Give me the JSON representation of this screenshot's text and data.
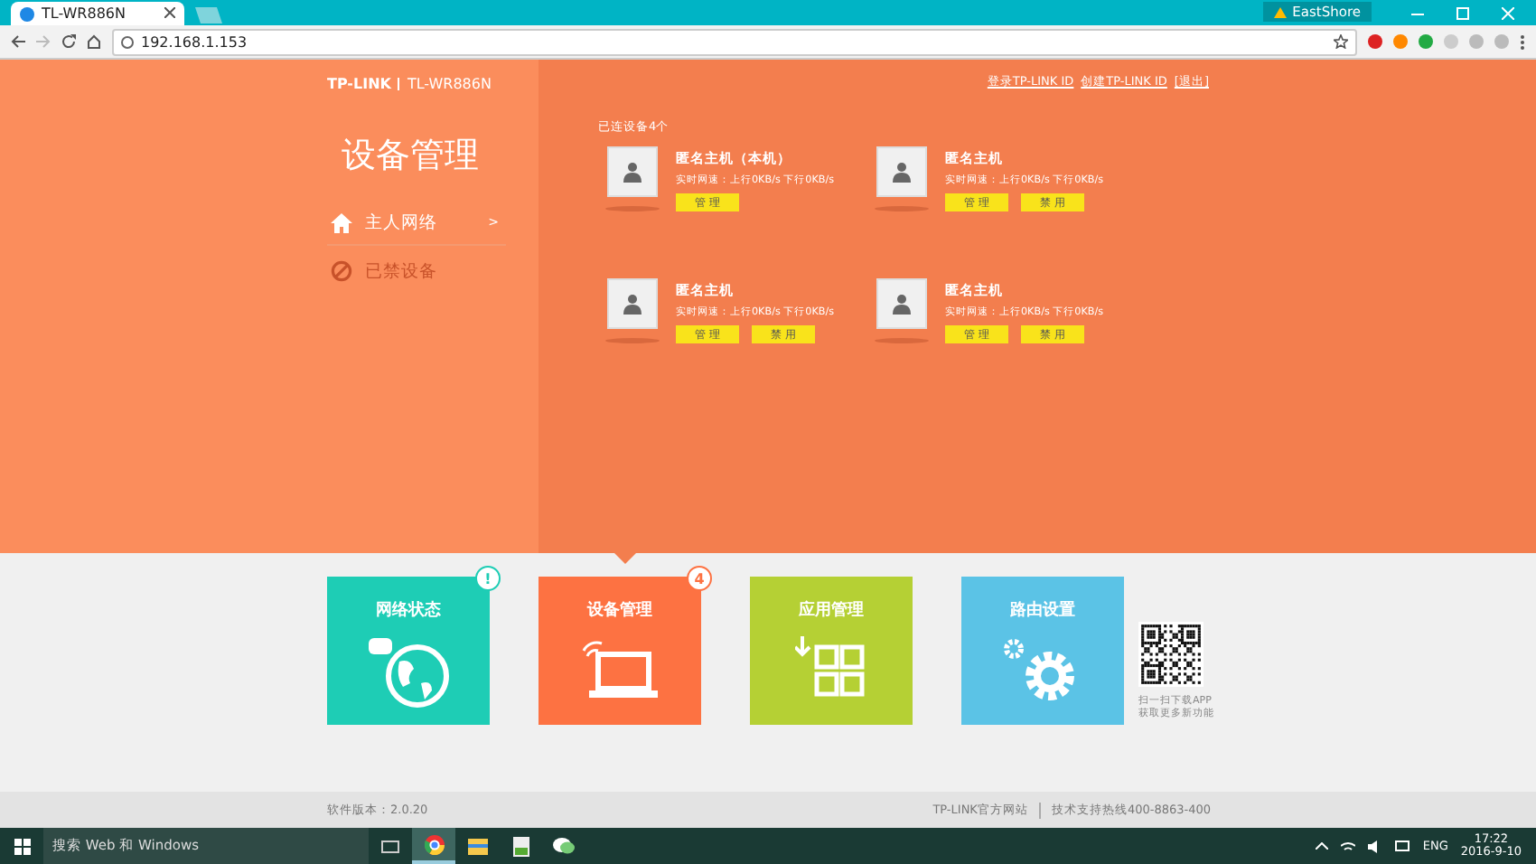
{
  "browser": {
    "tab_title": "TL-WR886N",
    "profile": "EastShore",
    "address": "192.168.1.153"
  },
  "header": {
    "brand": "TP-LINK",
    "model": "TL-WR886N",
    "links": [
      "登录TP-LINK ID",
      "创建TP-LINK ID",
      "[退出]"
    ]
  },
  "sidebar": {
    "title": "设备管理",
    "items": [
      {
        "label": "主人网络",
        "arrow": ">",
        "selected": true
      },
      {
        "label": "已禁设备",
        "selected": false
      }
    ]
  },
  "devices": {
    "count": "已连设备4个",
    "list": [
      {
        "name": "匿名主机（本机）",
        "speed": "实时网速：上行0KB/s  下行0KB/s",
        "buttons": [
          "管 理"
        ]
      },
      {
        "name": "匿名主机",
        "speed": "实时网速：上行0KB/s  下行0KB/s",
        "buttons": [
          "管 理",
          "禁 用"
        ]
      },
      {
        "name": "匿名主机",
        "speed": "实时网速：上行0KB/s  下行0KB/s",
        "buttons": [
          "管 理",
          "禁 用"
        ]
      },
      {
        "name": "匿名主机",
        "speed": "实时网速：上行0KB/s  下行0KB/s",
        "buttons": [
          "管 理",
          "禁 用"
        ]
      }
    ]
  },
  "tiles": [
    {
      "kind": "network",
      "label": "网络状态",
      "badge": "!",
      "color": "#1ecdb5",
      "selected": false
    },
    {
      "kind": "devices",
      "label": "设备管理",
      "badge": "4",
      "color": "#fd7242",
      "selected": true
    },
    {
      "kind": "apps",
      "label": "应用管理",
      "color": "#b5d034",
      "selected": false
    },
    {
      "kind": "router",
      "label": "路由设置",
      "color": "#5bc3e6",
      "selected": false
    }
  ],
  "qr": {
    "caption": [
      "扫一扫下载APP",
      "获取更多新功能"
    ]
  },
  "footer": {
    "version": "软件版本：2.0.20",
    "links": [
      "TP-LINK官方网站",
      "技术支持热线400-8863-400"
    ]
  },
  "taskbar": {
    "search": "搜索 Web 和 Windows",
    "language": "ENG",
    "time": "17:22",
    "date": "2016-9-10"
  }
}
